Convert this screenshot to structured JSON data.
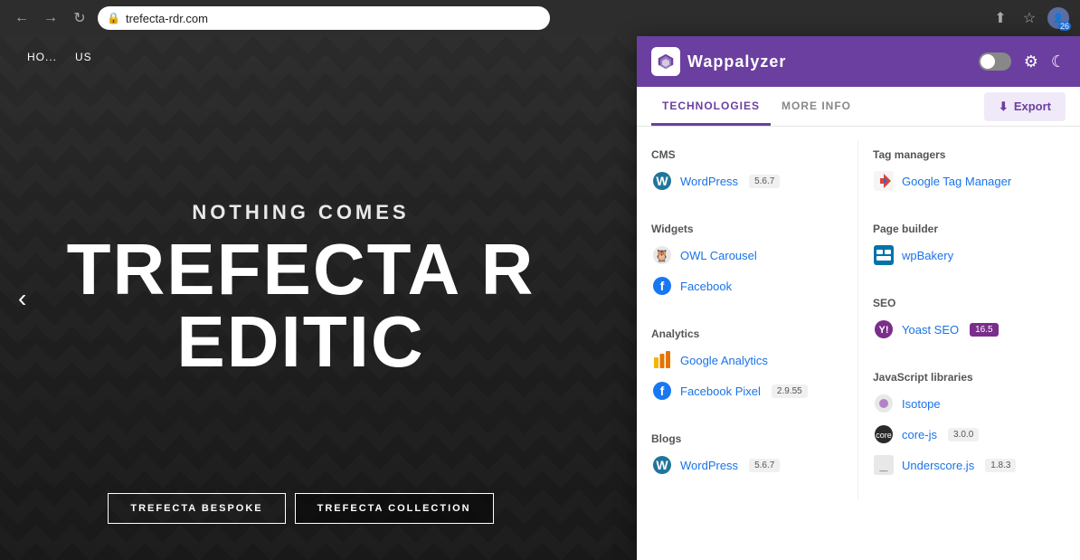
{
  "browser": {
    "back_label": "←",
    "forward_label": "→",
    "reload_label": "↺",
    "url": "trefecta-rdr.com",
    "lock_icon": "🔒",
    "share_icon": "⬆",
    "star_icon": "☆",
    "avatar_count": "26"
  },
  "page": {
    "nav_items": [
      "HO...",
      "US"
    ],
    "prev_arrow": "‹",
    "nothing_comes": "NOTHING COMES",
    "trefecta_big": "TREFECTA R",
    "edition_big": "EDITIC",
    "btn_bespoke": "TREFECTA BESPOKE",
    "btn_collection": "TREFECTA COLLECTION"
  },
  "wappalyzer": {
    "logo_text": "Wappalyzer",
    "tabs": {
      "technologies": "TECHNOLOGIES",
      "more_info": "MORE INFO"
    },
    "export_label": "Export",
    "export_icon": "⬇",
    "sections": {
      "cms": {
        "title": "CMS",
        "items": [
          {
            "name": "WordPress",
            "version": "5.6.7",
            "icon": "wp"
          }
        ]
      },
      "tag_managers": {
        "title": "Tag managers",
        "items": [
          {
            "name": "Google Tag Manager",
            "version": "",
            "icon": "gtm"
          }
        ]
      },
      "widgets": {
        "title": "Widgets",
        "items": [
          {
            "name": "OWL Carousel",
            "version": "",
            "icon": "owl"
          },
          {
            "name": "Facebook",
            "version": "",
            "icon": "fb"
          }
        ]
      },
      "page_builder": {
        "title": "Page builder",
        "items": [
          {
            "name": "wpBakery",
            "version": "",
            "icon": "wpbakery"
          }
        ]
      },
      "analytics": {
        "title": "Analytics",
        "items": [
          {
            "name": "Google Analytics",
            "version": "",
            "icon": "ga"
          },
          {
            "name": "Facebook Pixel",
            "version": "2.9.55",
            "icon": "fb"
          }
        ]
      },
      "seo": {
        "title": "SEO",
        "items": [
          {
            "name": "Yoast SEO",
            "version": "16.5",
            "icon": "yoast"
          }
        ]
      },
      "blogs": {
        "title": "Blogs",
        "items": [
          {
            "name": "WordPress",
            "version": "5.6.7",
            "icon": "wp"
          }
        ]
      },
      "javascript_libraries": {
        "title": "JavaScript libraries",
        "items": [
          {
            "name": "Isotope",
            "version": "",
            "icon": "isotope"
          },
          {
            "name": "core-js",
            "version": "3.0.0",
            "icon": "corejs"
          },
          {
            "name": "Underscore.js",
            "version": "1.8.3",
            "icon": "underscore"
          }
        ]
      }
    }
  }
}
